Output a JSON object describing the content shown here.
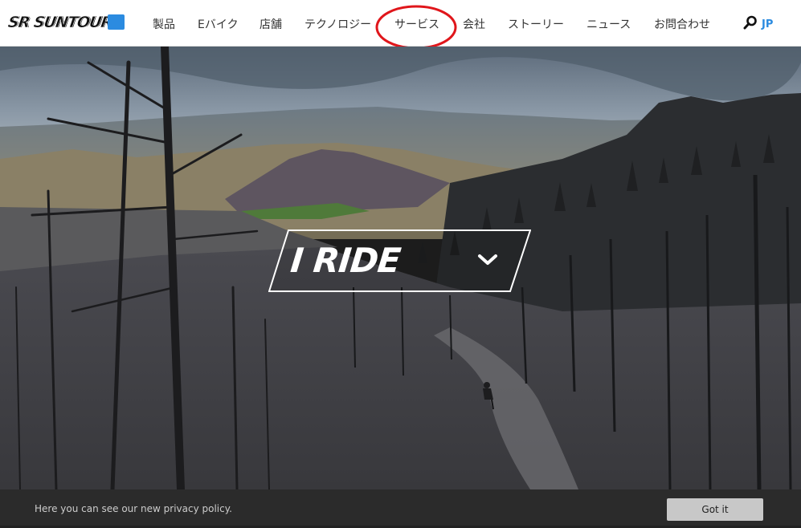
{
  "brand": {
    "logo_text": "SR SUNTOUR",
    "logo_color": "#2b8be0"
  },
  "nav": {
    "items": [
      {
        "label": "製品"
      },
      {
        "label": "Eバイク"
      },
      {
        "label": "店舗"
      },
      {
        "label": "テクノロジー"
      },
      {
        "label": "サービス"
      },
      {
        "label": "会社"
      },
      {
        "label": "ストーリー"
      },
      {
        "label": "ニュース"
      },
      {
        "label": "お問合わせ"
      }
    ],
    "language": "JP",
    "highlighted_item": "サービス",
    "highlight_color": "#e0161b"
  },
  "hero": {
    "headline": "I RIDE",
    "scroll_icon": "chevron-down-icon"
  },
  "cookie_banner": {
    "message": "Here you can see our new privacy policy.",
    "button_label": "Got it"
  }
}
